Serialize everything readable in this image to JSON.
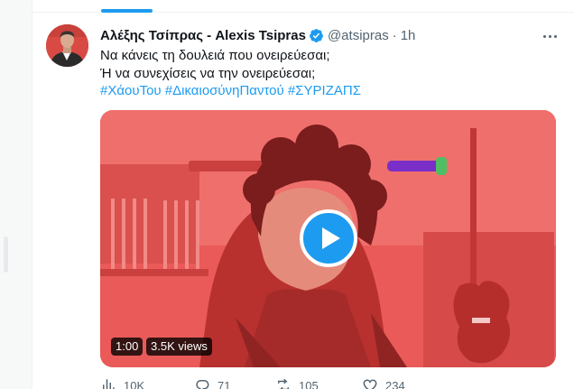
{
  "tweet": {
    "display_name": "Αλέξης Τσίπρας - Alexis Tsipras",
    "handle": "@atsipras",
    "separator": "·",
    "time": "1h",
    "text_lines": [
      "Να κάνεις τη δουλειά που ονειρεύεσαι;",
      "Ή να συνεχίσεις να την ονειρεύεσαι;"
    ],
    "hashtags": [
      "#ΧάουΤου",
      "#ΔικαιοσύνηΠαντού",
      "#ΣΥΡΙΖΑΠΣ"
    ]
  },
  "video": {
    "duration": "1:00",
    "views": "3.5K views",
    "tint_color": "#e95a58"
  },
  "actions": {
    "views": "10K",
    "replies": "71",
    "retweets": "105",
    "likes": "234"
  },
  "colors": {
    "accent": "#1d9bf0",
    "text": "#0f1419",
    "secondary": "#536471"
  },
  "icons": [
    "verified-badge-icon",
    "more-options-icon",
    "play-icon",
    "analytics-icon",
    "reply-icon",
    "retweet-icon",
    "like-icon"
  ]
}
